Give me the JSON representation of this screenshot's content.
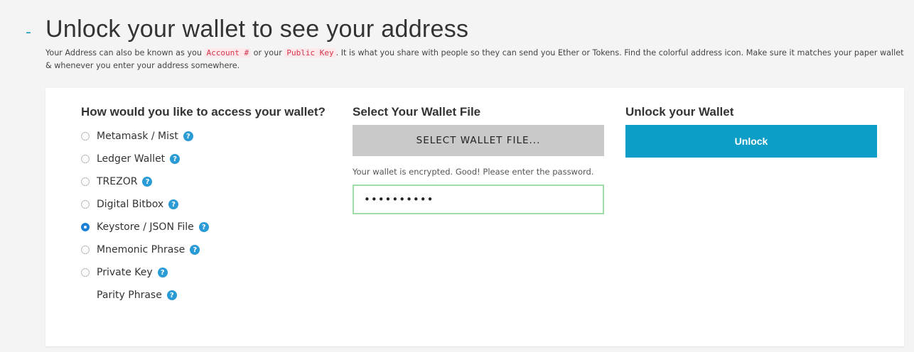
{
  "header": {
    "toggle": "-",
    "title": "Unlock your wallet to see your address"
  },
  "intro": {
    "part1": "Your Address can also be known as you ",
    "code1": "Account #",
    "part2": " or your ",
    "code2": "Public Key",
    "part3": ". It is what you share with people so they can send you Ether or Tokens. Find the colorful address icon. Make sure it matches your paper wallet & whenever you enter your address somewhere."
  },
  "access": {
    "heading": "How would you like to access your wallet?",
    "help_glyph": "?",
    "options": [
      {
        "label": "Metamask / Mist",
        "checked": false
      },
      {
        "label": "Ledger Wallet",
        "checked": false
      },
      {
        "label": "TREZOR",
        "checked": false
      },
      {
        "label": "Digital Bitbox",
        "checked": false
      },
      {
        "label": "Keystore / JSON File",
        "checked": true
      },
      {
        "label": "Mnemonic Phrase",
        "checked": false
      },
      {
        "label": "Private Key",
        "checked": false
      },
      {
        "label": "Parity Phrase",
        "checked": false,
        "no_radio": true
      }
    ]
  },
  "file": {
    "heading": "Select Your Wallet File",
    "button_label": "SELECT WALLET FILE...",
    "status": "Your wallet is encrypted. Good! Please enter the password.",
    "password_value": "••••••••••"
  },
  "unlock": {
    "heading": "Unlock your Wallet",
    "button_label": "Unlock"
  },
  "colors": {
    "accent": "#0d9ec8",
    "help": "#2b9bd6",
    "code_text": "#d6334a",
    "code_bg": "#fde9ec",
    "input_border": "#9edba7",
    "file_button": "#c9c9c9"
  }
}
